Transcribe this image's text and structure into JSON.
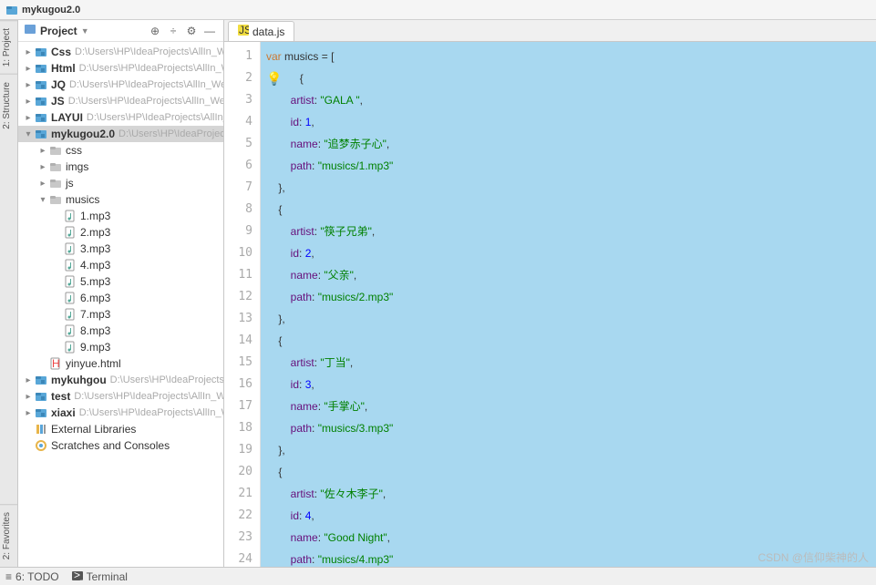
{
  "window": {
    "title": "mykugou2.0"
  },
  "rail": {
    "structure": "2: Structure",
    "project": "1: Project",
    "favorites": "2: Favorites"
  },
  "panel": {
    "title": "Project",
    "items": [
      {
        "d": 0,
        "exp": "closed",
        "icon": "module",
        "name": "Css",
        "bold": true,
        "suffix": "D:\\Users\\HP\\IdeaProjects\\AllIn_Web\\"
      },
      {
        "d": 0,
        "exp": "closed",
        "icon": "module",
        "name": "Html",
        "bold": true,
        "suffix": "D:\\Users\\HP\\IdeaProjects\\AllIn_We"
      },
      {
        "d": 0,
        "exp": "closed",
        "icon": "module",
        "name": "JQ",
        "bold": true,
        "suffix": "D:\\Users\\HP\\IdeaProjects\\AllIn_Web\\"
      },
      {
        "d": 0,
        "exp": "closed",
        "icon": "module",
        "name": "JS",
        "bold": true,
        "suffix": "D:\\Users\\HP\\IdeaProjects\\AllIn_Web\\"
      },
      {
        "d": 0,
        "exp": "closed",
        "icon": "module",
        "name": "LAYUI",
        "bold": true,
        "suffix": "D:\\Users\\HP\\IdeaProjects\\AllIn_W"
      },
      {
        "d": 0,
        "exp": "open",
        "icon": "module",
        "name": "mykugou2.0",
        "bold": true,
        "suffix": "D:\\Users\\HP\\IdeaProjects\\",
        "sel": true
      },
      {
        "d": 1,
        "exp": "closed",
        "icon": "folder",
        "name": "css"
      },
      {
        "d": 1,
        "exp": "closed",
        "icon": "folder",
        "name": "imgs"
      },
      {
        "d": 1,
        "exp": "closed",
        "icon": "folder",
        "name": "js"
      },
      {
        "d": 1,
        "exp": "open",
        "icon": "folder",
        "name": "musics"
      },
      {
        "d": 2,
        "exp": "none",
        "icon": "audio",
        "name": "1.mp3"
      },
      {
        "d": 2,
        "exp": "none",
        "icon": "audio",
        "name": "2.mp3"
      },
      {
        "d": 2,
        "exp": "none",
        "icon": "audio",
        "name": "3.mp3"
      },
      {
        "d": 2,
        "exp": "none",
        "icon": "audio",
        "name": "4.mp3"
      },
      {
        "d": 2,
        "exp": "none",
        "icon": "audio",
        "name": "5.mp3"
      },
      {
        "d": 2,
        "exp": "none",
        "icon": "audio",
        "name": "6.mp3"
      },
      {
        "d": 2,
        "exp": "none",
        "icon": "audio",
        "name": "7.mp3"
      },
      {
        "d": 2,
        "exp": "none",
        "icon": "audio",
        "name": "8.mp3"
      },
      {
        "d": 2,
        "exp": "none",
        "icon": "audio",
        "name": "9.mp3"
      },
      {
        "d": 1,
        "exp": "none",
        "icon": "html",
        "name": "yinyue.html"
      },
      {
        "d": 0,
        "exp": "closed",
        "icon": "module",
        "name": "mykuhgou",
        "bold": true,
        "suffix": "D:\\Users\\HP\\IdeaProjects\\Al"
      },
      {
        "d": 0,
        "exp": "closed",
        "icon": "module",
        "name": "test",
        "bold": true,
        "suffix": "D:\\Users\\HP\\IdeaProjects\\AllIn_Web"
      },
      {
        "d": 0,
        "exp": "closed",
        "icon": "module",
        "name": "xiaxi",
        "bold": true,
        "suffix": "D:\\Users\\HP\\IdeaProjects\\AllIn_Web"
      },
      {
        "d": 0,
        "exp": "none",
        "icon": "lib",
        "name": "External Libraries"
      },
      {
        "d": 0,
        "exp": "none",
        "icon": "scratch",
        "name": "Scratches and Consoles"
      }
    ]
  },
  "tabs": [
    {
      "label": "data.js",
      "icon": "js"
    }
  ],
  "code": {
    "lines": [
      {
        "n": 1,
        "bulb": false,
        "tokens": [
          [
            "kw",
            "var"
          ],
          [
            "sp",
            " "
          ],
          [
            "var",
            "musics"
          ],
          [
            "sp",
            " "
          ],
          [
            "punc",
            "="
          ],
          [
            "sp",
            " "
          ],
          [
            "punc",
            "["
          ]
        ]
      },
      {
        "n": 2,
        "bulb": true,
        "tokens": [
          [
            "sp",
            "    "
          ],
          [
            "punc",
            "{"
          ]
        ]
      },
      {
        "n": 3,
        "bulb": false,
        "tokens": [
          [
            "sp",
            "        "
          ],
          [
            "prop",
            "artist"
          ],
          [
            "punc",
            ":"
          ],
          [
            "sp",
            " "
          ],
          [
            "str",
            "\"GALA \""
          ],
          [
            "punc",
            ","
          ]
        ]
      },
      {
        "n": 4,
        "bulb": false,
        "tokens": [
          [
            "sp",
            "        "
          ],
          [
            "prop",
            "id"
          ],
          [
            "punc",
            ":"
          ],
          [
            "sp",
            " "
          ],
          [
            "num",
            "1"
          ],
          [
            "punc",
            ","
          ]
        ]
      },
      {
        "n": 5,
        "bulb": false,
        "tokens": [
          [
            "sp",
            "        "
          ],
          [
            "prop",
            "name"
          ],
          [
            "punc",
            ":"
          ],
          [
            "sp",
            " "
          ],
          [
            "str",
            "\"追梦赤子心\""
          ],
          [
            "punc",
            ","
          ]
        ]
      },
      {
        "n": 6,
        "bulb": false,
        "tokens": [
          [
            "sp",
            "        "
          ],
          [
            "prop",
            "path"
          ],
          [
            "punc",
            ":"
          ],
          [
            "sp",
            " "
          ],
          [
            "str",
            "\"musics/1.mp3\""
          ]
        ]
      },
      {
        "n": 7,
        "bulb": false,
        "tokens": [
          [
            "sp",
            "    "
          ],
          [
            "punc",
            "},"
          ]
        ]
      },
      {
        "n": 8,
        "bulb": false,
        "tokens": [
          [
            "sp",
            "    "
          ],
          [
            "punc",
            "{"
          ]
        ]
      },
      {
        "n": 9,
        "bulb": false,
        "tokens": [
          [
            "sp",
            "        "
          ],
          [
            "prop",
            "artist"
          ],
          [
            "punc",
            ":"
          ],
          [
            "sp",
            " "
          ],
          [
            "str",
            "\"筷子兄弟\""
          ],
          [
            "punc",
            ","
          ]
        ]
      },
      {
        "n": 10,
        "bulb": false,
        "tokens": [
          [
            "sp",
            "        "
          ],
          [
            "prop",
            "id"
          ],
          [
            "punc",
            ":"
          ],
          [
            "sp",
            " "
          ],
          [
            "num",
            "2"
          ],
          [
            "punc",
            ","
          ]
        ]
      },
      {
        "n": 11,
        "bulb": false,
        "tokens": [
          [
            "sp",
            "        "
          ],
          [
            "prop",
            "name"
          ],
          [
            "punc",
            ":"
          ],
          [
            "sp",
            " "
          ],
          [
            "str",
            "\"父亲\""
          ],
          [
            "punc",
            ","
          ]
        ]
      },
      {
        "n": 12,
        "bulb": false,
        "tokens": [
          [
            "sp",
            "        "
          ],
          [
            "prop",
            "path"
          ],
          [
            "punc",
            ":"
          ],
          [
            "sp",
            " "
          ],
          [
            "str",
            "\"musics/2.mp3\""
          ]
        ]
      },
      {
        "n": 13,
        "bulb": false,
        "tokens": [
          [
            "sp",
            "    "
          ],
          [
            "punc",
            "},"
          ]
        ]
      },
      {
        "n": 14,
        "bulb": false,
        "tokens": [
          [
            "sp",
            "    "
          ],
          [
            "punc",
            "{"
          ]
        ]
      },
      {
        "n": 15,
        "bulb": false,
        "tokens": [
          [
            "sp",
            "        "
          ],
          [
            "prop",
            "artist"
          ],
          [
            "punc",
            ":"
          ],
          [
            "sp",
            " "
          ],
          [
            "str",
            "\"丁当\""
          ],
          [
            "punc",
            ","
          ]
        ]
      },
      {
        "n": 16,
        "bulb": false,
        "tokens": [
          [
            "sp",
            "        "
          ],
          [
            "prop",
            "id"
          ],
          [
            "punc",
            ":"
          ],
          [
            "sp",
            " "
          ],
          [
            "num",
            "3"
          ],
          [
            "punc",
            ","
          ]
        ]
      },
      {
        "n": 17,
        "bulb": false,
        "tokens": [
          [
            "sp",
            "        "
          ],
          [
            "prop",
            "name"
          ],
          [
            "punc",
            ":"
          ],
          [
            "sp",
            " "
          ],
          [
            "str",
            "\"手掌心\""
          ],
          [
            "punc",
            ","
          ]
        ]
      },
      {
        "n": 18,
        "bulb": false,
        "tokens": [
          [
            "sp",
            "        "
          ],
          [
            "prop",
            "path"
          ],
          [
            "punc",
            ":"
          ],
          [
            "sp",
            " "
          ],
          [
            "str",
            "\"musics/3.mp3\""
          ]
        ]
      },
      {
        "n": 19,
        "bulb": false,
        "tokens": [
          [
            "sp",
            "    "
          ],
          [
            "punc",
            "},"
          ]
        ]
      },
      {
        "n": 20,
        "bulb": false,
        "tokens": [
          [
            "sp",
            "    "
          ],
          [
            "punc",
            "{"
          ]
        ]
      },
      {
        "n": 21,
        "bulb": false,
        "tokens": [
          [
            "sp",
            "        "
          ],
          [
            "prop",
            "artist"
          ],
          [
            "punc",
            ":"
          ],
          [
            "sp",
            " "
          ],
          [
            "str",
            "\"佐々木李子\""
          ],
          [
            "punc",
            ","
          ]
        ]
      },
      {
        "n": 22,
        "bulb": false,
        "tokens": [
          [
            "sp",
            "        "
          ],
          [
            "prop",
            "id"
          ],
          [
            "punc",
            ":"
          ],
          [
            "sp",
            " "
          ],
          [
            "num",
            "4"
          ],
          [
            "punc",
            ","
          ]
        ]
      },
      {
        "n": 23,
        "bulb": false,
        "tokens": [
          [
            "sp",
            "        "
          ],
          [
            "prop",
            "name"
          ],
          [
            "punc",
            ":"
          ],
          [
            "sp",
            " "
          ],
          [
            "str",
            "\"Good Night\""
          ],
          [
            "punc",
            ","
          ]
        ]
      },
      {
        "n": 24,
        "bulb": false,
        "tokens": [
          [
            "sp",
            "        "
          ],
          [
            "prop",
            "path"
          ],
          [
            "punc",
            ":"
          ],
          [
            "sp",
            " "
          ],
          [
            "str",
            "\"musics/4.mp3\""
          ]
        ]
      }
    ]
  },
  "status": {
    "todo": "6: TODO",
    "terminal": "Terminal"
  },
  "watermark": "CSDN @信仰柴神的人"
}
